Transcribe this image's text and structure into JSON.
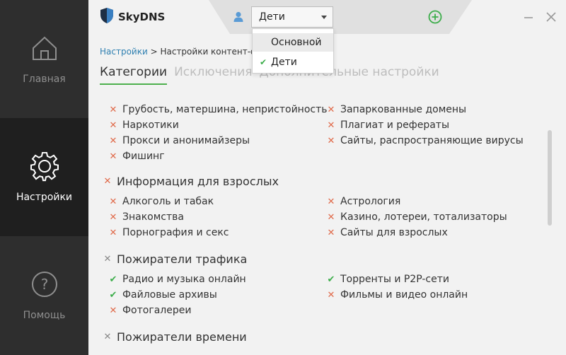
{
  "app": {
    "name": "SkyDNS"
  },
  "sidebar": {
    "items": [
      {
        "label": "Главная",
        "icon": "home-icon",
        "active": false
      },
      {
        "label": "Настройки",
        "icon": "gear-icon",
        "active": true
      },
      {
        "label": "Помощь",
        "icon": "help-icon",
        "active": false
      }
    ]
  },
  "header": {
    "profile_selected": "Дети",
    "user_icon": "user-icon",
    "add_icon": "add-profile-icon"
  },
  "dropdown": {
    "options": [
      {
        "label": "Основной",
        "checked": false
      },
      {
        "label": "Дети",
        "checked": true
      }
    ]
  },
  "breadcrumb": {
    "link": "Настройки",
    "separator": " > ",
    "current": "Настройки контент-фи"
  },
  "tabs": [
    {
      "label": "Категории",
      "active": true
    },
    {
      "label": "Исключения",
      "active": false
    },
    {
      "label": "Дополнительные настройки",
      "active": false
    }
  ],
  "categories": {
    "top_left": [
      {
        "label": "Грубость, матершина, непристойность",
        "status": "blocked"
      },
      {
        "label": "Наркотики",
        "status": "blocked"
      },
      {
        "label": "Прокси и анонимайзеры",
        "status": "blocked"
      },
      {
        "label": "Фишинг",
        "status": "blocked"
      }
    ],
    "top_right": [
      {
        "label": "Запаркованные домены",
        "status": "blocked"
      },
      {
        "label": "Плагиат и рефераты",
        "status": "blocked"
      },
      {
        "label": "Сайты, распространяющие вирусы",
        "status": "blocked"
      }
    ],
    "groups": [
      {
        "label": "Информация для взрослых",
        "status": "blocked",
        "left": [
          {
            "label": "Алкоголь и табак",
            "status": "blocked"
          },
          {
            "label": "Знакомства",
            "status": "blocked"
          },
          {
            "label": "Порнография и секс",
            "status": "blocked"
          }
        ],
        "right": [
          {
            "label": "Астрология",
            "status": "blocked"
          },
          {
            "label": "Казино, лотереи, тотализаторы",
            "status": "blocked"
          },
          {
            "label": "Сайты для взрослых",
            "status": "blocked"
          }
        ]
      },
      {
        "label": "Пожиратели трафика",
        "status": "partial",
        "left": [
          {
            "label": "Радио и музыка онлайн",
            "status": "allowed"
          },
          {
            "label": "Файловые архивы",
            "status": "allowed"
          },
          {
            "label": "Фотогалереи",
            "status": "blocked"
          }
        ],
        "right": [
          {
            "label": "Торренты и P2P-сети",
            "status": "allowed"
          },
          {
            "label": "Фильмы и видео онлайн",
            "status": "blocked"
          }
        ]
      },
      {
        "label": "Пожиратели времени",
        "status": "partial",
        "left": [],
        "right": []
      }
    ]
  },
  "marks": {
    "blocked": "✕",
    "allowed": "✔",
    "partial": "✕"
  },
  "colors": {
    "sidebar": "#2e2e2e",
    "sidebar_active": "#1f1f1f",
    "accent_green": "#4db04d",
    "blocked_red": "#e06a4a",
    "link_blue": "#2e7fb0"
  }
}
